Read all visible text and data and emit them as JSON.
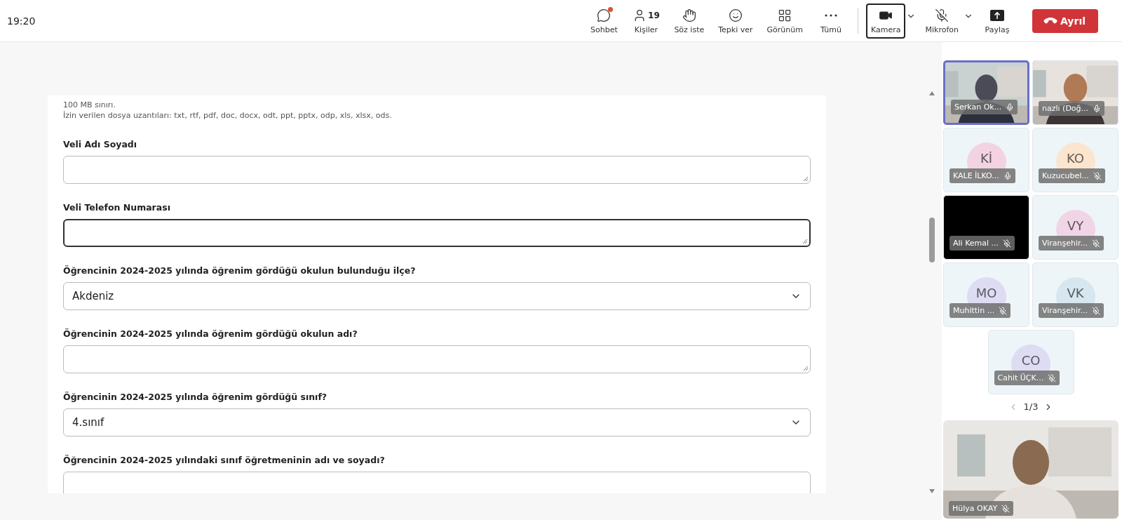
{
  "clock": "19:20",
  "toolbar": [
    {
      "kind": "chat",
      "label": "Sohbet",
      "selected": false,
      "notification": true,
      "dropdown": false
    },
    {
      "kind": "people",
      "label": "Kişiler",
      "count": "19",
      "selected": false,
      "notification": false,
      "dropdown": false
    },
    {
      "kind": "raise",
      "label": "Söz iste",
      "selected": false,
      "notification": false,
      "dropdown": false
    },
    {
      "kind": "react",
      "label": "Tepki ver",
      "selected": false,
      "notification": false,
      "dropdown": false
    },
    {
      "kind": "view",
      "label": "Görünüm",
      "selected": false,
      "notification": false,
      "dropdown": false
    },
    {
      "kind": "more",
      "label": "Tümü",
      "selected": false,
      "notification": false,
      "dropdown": false
    },
    {
      "kind": "camera",
      "label": "Kamera",
      "selected": true,
      "notification": false,
      "dropdown": true
    },
    {
      "kind": "mic",
      "label": "Mikrofon",
      "muted": true,
      "selected": false,
      "notification": false,
      "dropdown": true
    },
    {
      "kind": "share",
      "label": "Paylaş",
      "selected": false,
      "notification": false,
      "dropdown": false
    }
  ],
  "leave_button": "Ayrıl",
  "form": {
    "notes": [
      "100 MB sınırı.",
      "İzin verilen dosya uzantıları: txt, rtf, pdf, doc, docx, odt, ppt, pptx, odp, xls, xlsx, ods."
    ],
    "questions": [
      {
        "label": "Veli Adı Soyadı",
        "kind": "text",
        "focused": false
      },
      {
        "label": "Veli Telefon Numarası",
        "kind": "text",
        "focused": true
      },
      {
        "label": "Öğrencinin 2024-2025 yılında öğrenim gördüğü okulun bulunduğu ilçe?",
        "kind": "select",
        "value": "Akdeniz",
        "focused": false
      },
      {
        "label": "Öğrencinin 2024-2025 yılında öğrenim gördüğü okulun adı?",
        "kind": "text",
        "focused": false
      },
      {
        "label": "Öğrencinin 2024-2025 yılında öğrenim gördüğü sınıf?",
        "kind": "select",
        "value": "4.sınıf",
        "focused": false
      },
      {
        "label": "Öğrencinin 2024-2025 yılındaki sınıf öğretmeninin adı ve soyadı?",
        "kind": "text",
        "focused": false
      }
    ]
  },
  "participants": [
    {
      "name": "Serkan Ok...",
      "kind": "video",
      "muted": false,
      "selected": true
    },
    {
      "name": "nazlı (Doğ...",
      "kind": "video",
      "muted": false,
      "selected": false
    },
    {
      "name": "KALE İLKO...",
      "kind": "avatar",
      "initials": "Kİ",
      "color": "#f3d3e2",
      "muted": false,
      "selected": false
    },
    {
      "name": "Kuzucubel...",
      "kind": "avatar",
      "initials": "KO",
      "color": "#fbe5cf",
      "muted": true,
      "selected": false
    },
    {
      "name": "Ali Kemal ...",
      "kind": "blank",
      "muted": true,
      "selected": false
    },
    {
      "name": "Viranşehir...",
      "kind": "avatar",
      "initials": "VY",
      "color": "#f0d5e6",
      "muted": true,
      "selected": false
    },
    {
      "name": "Muhittin ...",
      "kind": "avatar",
      "initials": "MO",
      "color": "#dddcf3",
      "muted": true,
      "selected": false
    },
    {
      "name": "Viranşehir...",
      "kind": "avatar",
      "initials": "VK",
      "color": "#d6e7ef",
      "muted": true,
      "selected": false
    },
    {
      "name": "Cahit ÜÇK...",
      "kind": "avatar",
      "initials": "CO",
      "color": "#dddcf3",
      "muted": true,
      "selected": false
    }
  ],
  "pager": "1/3",
  "self_view": {
    "name": "Hülya OKAY",
    "muted": true
  }
}
